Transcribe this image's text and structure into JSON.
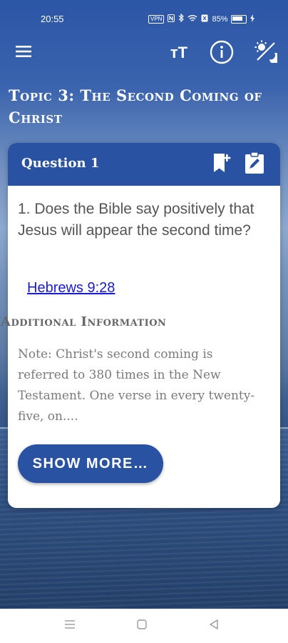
{
  "status_bar": {
    "time": "20:55",
    "vpn": "VPN",
    "battery": "85%",
    "icons": [
      "vpn-icon",
      "nfc-icon",
      "bluetooth-icon",
      "wifi-icon",
      "sim-icon",
      "battery-icon",
      "charging-icon"
    ]
  },
  "app_bar": {
    "icons": [
      "menu-icon",
      "text-size-icon",
      "info-icon",
      "theme-icon"
    ],
    "text_size_label": "тT"
  },
  "topic_title": "Topic 3: The Second Coming of Christ",
  "card": {
    "title": "Question 1",
    "icons": [
      "bookmark-add-icon",
      "edit-note-icon"
    ],
    "question": "1. Does the Bible say positively that Jesus will appear the second time?",
    "reference": "Hebrews 9:28",
    "additional_heading": "Additional Information",
    "note": "Note: Christ's second coming is referred to 380 times in the New Testament. One verse in every twenty-five, on....",
    "show_more_label": "SHOW MORE…"
  },
  "nav_bar": {
    "icons": [
      "recent-apps-icon",
      "home-icon",
      "back-icon"
    ]
  },
  "colors": {
    "primary": "#2a52a3",
    "link": "#1a1adb",
    "card_bg": "#ffffff"
  }
}
